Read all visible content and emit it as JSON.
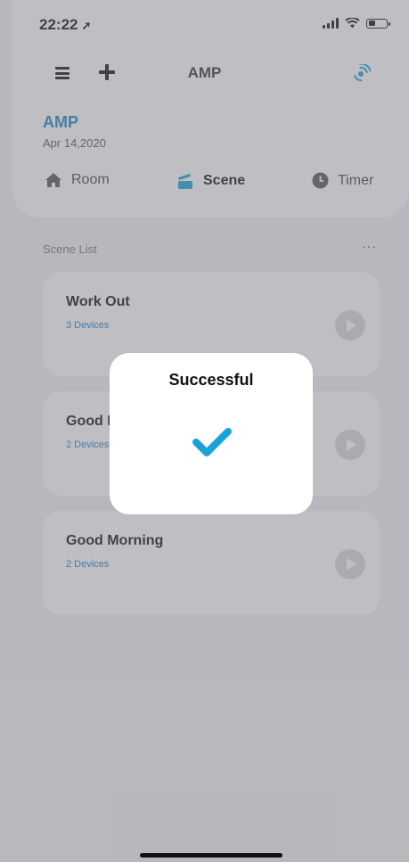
{
  "status_bar": {
    "time": "22:22",
    "location_arrow": "location-arrow-icon",
    "battery_level": 0.45
  },
  "header": {
    "title": "AMP",
    "device_name": "AMP",
    "date": "Apr 14,2020",
    "icons": [
      "menu-icon",
      "plus-icon",
      "signal-logo-icon"
    ]
  },
  "tabs": [
    {
      "label": "Room",
      "icon": "home-icon",
      "active": false
    },
    {
      "label": "Scene",
      "icon": "scene-icon",
      "active": true
    },
    {
      "label": "Timer",
      "icon": "clock-icon",
      "active": false
    }
  ],
  "scene_list": {
    "label": "Scene List",
    "more": "···",
    "items": [
      {
        "title": "Work Out",
        "subtitle": "3 Devices"
      },
      {
        "title": "Good N",
        "subtitle": "2 Devices"
      },
      {
        "title": "Good Morning",
        "subtitle": "2 Devices"
      }
    ]
  },
  "dialog": {
    "title": "Successful",
    "icon": "checkmark-icon"
  },
  "colors": {
    "accent": "#1b86c2",
    "check": "#1aa3d9",
    "overlay": "#78787f"
  }
}
